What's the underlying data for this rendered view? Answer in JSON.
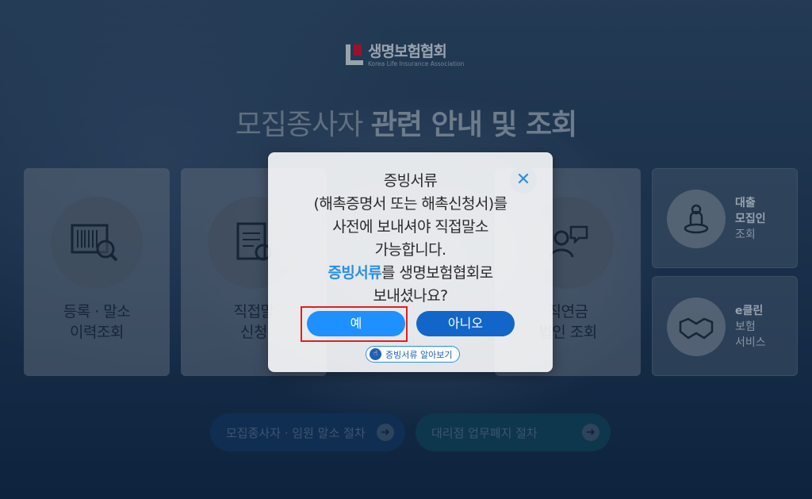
{
  "logo": {
    "name_kr": "생명보험협회",
    "name_en": "Korea Life Insurance Association"
  },
  "page": {
    "title_light": "모집종사자 ",
    "title_bold": "관련 안내 및 조회"
  },
  "cards": [
    {
      "line1": "등록 · 말소",
      "line2": "이력조회"
    },
    {
      "line1": "직접말",
      "line2": "신청"
    },
    {
      "line1": "직연금",
      "line2": "법인 조회"
    }
  ],
  "side_cards": [
    {
      "line1": "대출",
      "line2": "모집인",
      "line3": "조회"
    },
    {
      "line1": "e클린",
      "line2": "보험",
      "line3": "서비스"
    }
  ],
  "pills": [
    {
      "label": "모집종사자 · 임원 말소 절차"
    },
    {
      "label": "대리점 업무폐지 절차"
    }
  ],
  "modal": {
    "line1": "증빙서류",
    "line2": "(해촉증명서 또는 해촉신청서)를",
    "line3": "사전에 보내셔야 직접말소",
    "line4": "가능합니다.",
    "line5_highlight": "증빙서류",
    "line5_rest": "를 생명보험협회로",
    "line6": "보내셨나요?",
    "yes_label": "예",
    "no_label": "아니오",
    "guide_label": "증빙서류 알아보기"
  },
  "colors": {
    "accent": "#2a8fe3",
    "yes_button": "#1e90ff",
    "no_button": "#1266c9",
    "highlight_frame": "#e02020"
  }
}
